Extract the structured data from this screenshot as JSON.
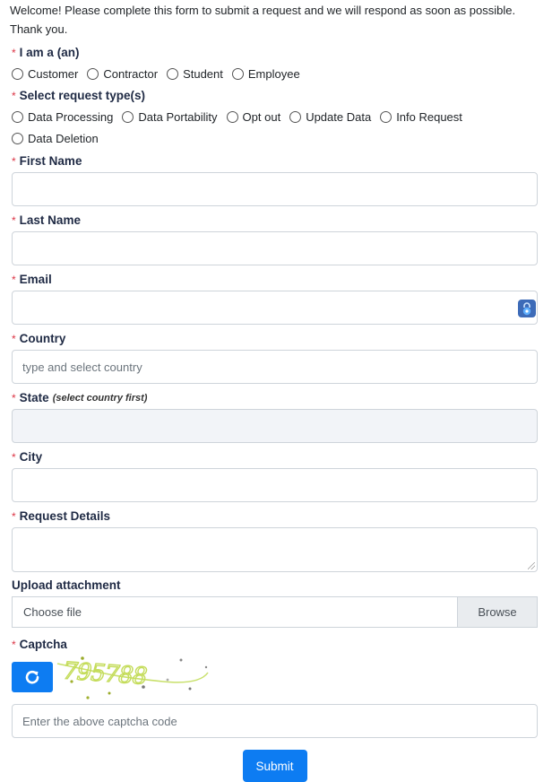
{
  "intro": {
    "line1": "Welcome! Please complete this form to submit a request and we will respond as soon as possible.",
    "line2": "Thank you."
  },
  "required_marker": "*",
  "role": {
    "label": "I am a (an)",
    "options": [
      "Customer",
      "Contractor",
      "Student",
      "Employee"
    ]
  },
  "request_type": {
    "label": "Select request type(s)",
    "options": [
      "Data Processing",
      "Data Portability",
      "Opt out",
      "Update Data",
      "Info Request",
      "Data Deletion"
    ]
  },
  "first_name": {
    "label": "First Name",
    "value": ""
  },
  "last_name": {
    "label": "Last Name",
    "value": ""
  },
  "email": {
    "label": "Email",
    "value": "",
    "icon": "password-manager-lock-icon"
  },
  "country": {
    "label": "Country",
    "placeholder": "type and select country"
  },
  "state": {
    "label": "State",
    "hint": "(select country first)",
    "value": ""
  },
  "city": {
    "label": "City",
    "value": ""
  },
  "request_details": {
    "label": "Request Details",
    "value": ""
  },
  "upload": {
    "label": "Upload attachment",
    "placeholder": "Choose file",
    "button": "Browse"
  },
  "captcha": {
    "label": "Captcha",
    "refresh_icon": "refresh-icon",
    "image_text": "795788",
    "placeholder": "Enter the above captcha code"
  },
  "submit": {
    "label": "Submit"
  },
  "colors": {
    "primary": "#0d7cf2",
    "required": "#dc3545",
    "disabled_bg": "#f2f4f8",
    "captcha_text": "#c8e06a"
  }
}
